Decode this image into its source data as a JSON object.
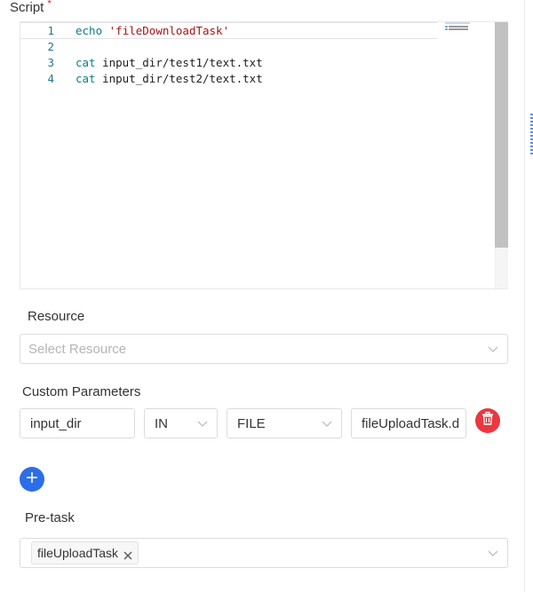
{
  "script": {
    "label": "Script",
    "required_mark": "*",
    "lines": [
      {
        "number": "1",
        "keyword": "echo",
        "rest": "'fileDownloadTask'"
      },
      {
        "number": "2",
        "keyword": "",
        "rest": ""
      },
      {
        "number": "3",
        "keyword": "cat",
        "rest": "input_dir/test1/text.txt"
      },
      {
        "number": "4",
        "keyword": "cat",
        "rest": "input_dir/test2/text.txt"
      }
    ]
  },
  "resource": {
    "label": "Resource",
    "placeholder": "Select Resource"
  },
  "custom_parameters": {
    "label": "Custom Parameters",
    "rows": [
      {
        "name": "input_dir",
        "direction": "IN",
        "type": "FILE",
        "value": "fileUploadTask.d"
      }
    ]
  },
  "pre_task": {
    "label": "Pre-task",
    "tags": [
      "fileUploadTask"
    ]
  },
  "colors": {
    "delete": "#e9383f",
    "add": "#2d6ee6",
    "required": "#f5222d"
  },
  "icons": {
    "delete": "trash-icon",
    "add": "plus-icon",
    "dropdown": "chevron-down-icon",
    "remove_tag": "close-icon"
  }
}
